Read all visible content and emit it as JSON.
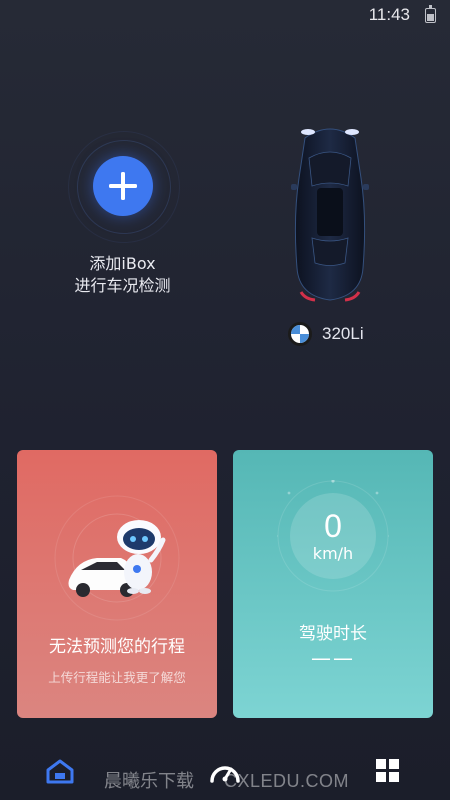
{
  "status": {
    "time": "11:43"
  },
  "add_ibox": {
    "line1": "添加iBox",
    "line2": "进行车况检测",
    "icon": "plus-icon"
  },
  "vehicle": {
    "model": "320Li",
    "brand_icon": "bmw-logo"
  },
  "trip_card": {
    "title": "无法预测您的行程",
    "subtitle": "上传行程能让我更了解您"
  },
  "speed_card": {
    "speed": "0",
    "unit": "km/h",
    "label": "驾驶时长",
    "duration": "——"
  },
  "nav": {
    "items": [
      "home-icon",
      "gauge-icon",
      "apps-icon"
    ],
    "active": "home-icon"
  },
  "watermark": {
    "text": "晨曦乐下载",
    "url": "CXLEDU.COM"
  },
  "colors": {
    "accent": "#3e78f0",
    "trip_card": "#e06a63",
    "speed_card": "#55b7b5",
    "background": "#232633"
  }
}
